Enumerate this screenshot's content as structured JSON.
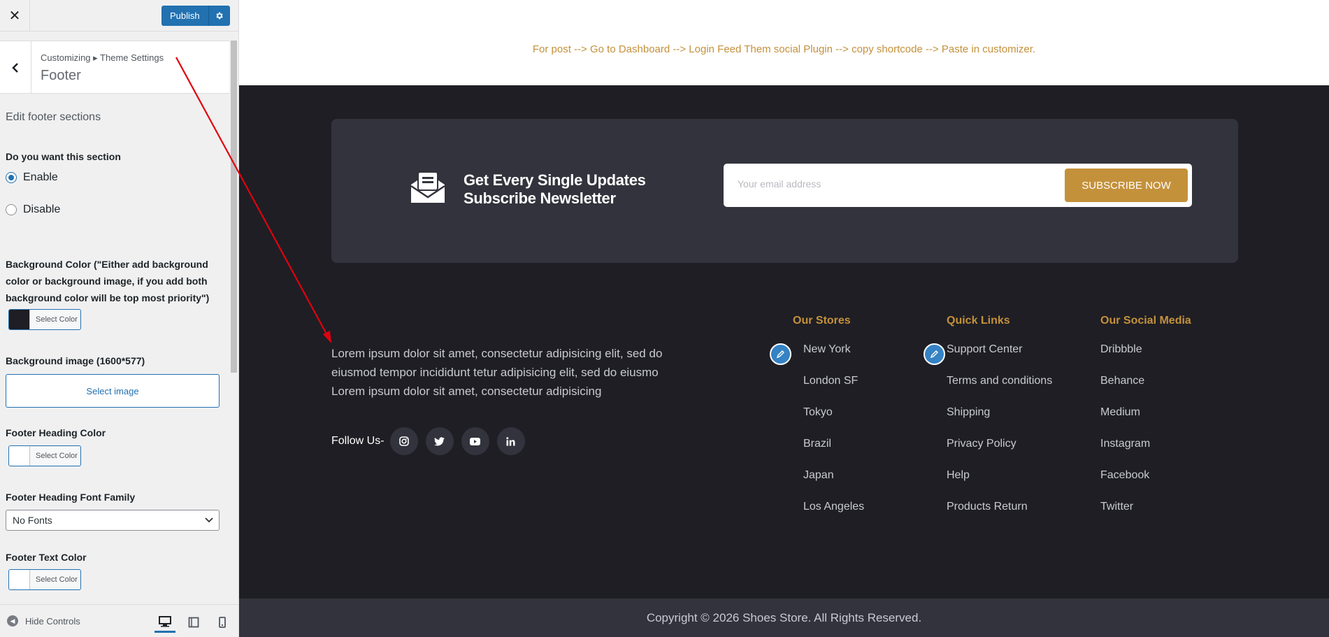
{
  "sidebar": {
    "publish_label": "Publish",
    "breadcrumb": "Customizing ▸ Theme Settings",
    "section_title": "Footer",
    "edit_heading": "Edit footer sections",
    "section_toggle_label": "Do you want this section",
    "enable_label": "Enable",
    "disable_label": "Disable",
    "bg_color_label": "Background Color (\"Either add background color or background image, if you add both background color will be top most priority\")",
    "select_color": "Select Color",
    "bg_image_label": "Background image (1600*577)",
    "select_image": "Select image",
    "heading_color_label": "Footer Heading Color",
    "heading_font_label": "Footer Heading Font Family",
    "font_value": "No Fonts",
    "text_color_label": "Footer Text Color",
    "hide_controls": "Hide Controls",
    "bg_swatch_color": "#1e1e24"
  },
  "preview": {
    "note": "For post --> Go to Dashboard --> Login Feed Them social Plugin --> copy shortcode --> Paste in customizer.",
    "newsletter": {
      "title_line1": "Get Every Single Updates",
      "title_line2": "Subscribe Newsletter",
      "email_placeholder": "Your email address",
      "subscribe_label": "SUBSCRIBE NOW"
    },
    "about_text": "Lorem ipsum dolor sit amet, consectetur adipisicing elit, sed do eiusmod tempor incididunt tetur adipisicing elit, sed do eiusmo Lorem ipsum dolor sit amet, consectetur adipisicing",
    "follow_label": "Follow Us-",
    "columns": [
      {
        "heading": "Our Stores",
        "items": [
          "New York",
          "London SF",
          "Tokyo",
          "Brazil",
          "Japan",
          "Los Angeles"
        ]
      },
      {
        "heading": "Quick Links",
        "items": [
          "Support Center",
          "Terms and conditions",
          "Shipping",
          "Privacy Policy",
          "Help",
          "Products Return"
        ]
      },
      {
        "heading": "Our Social Media",
        "items": [
          "Dribbble",
          "Behance",
          "Medium",
          "Instagram",
          "Facebook",
          "Twitter"
        ]
      }
    ],
    "copyright": "Copyright © 2026 Shoes Store. All Rights Reserved."
  },
  "colors": {
    "accent": "#c4913b",
    "wp_blue": "#2271b1",
    "footer_bg": "#1e1e24",
    "box_bg": "#33333d",
    "annotation": "#e3000f"
  }
}
